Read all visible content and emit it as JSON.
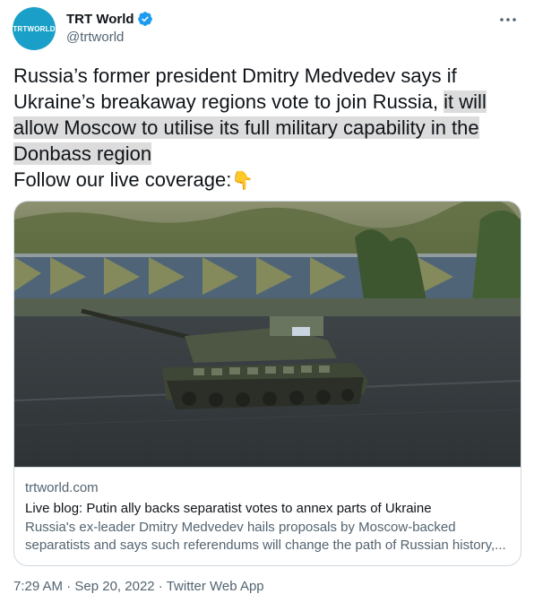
{
  "account": {
    "avatar_text": "TRTWORLD",
    "display_name": "TRT World",
    "handle": "@trtworld",
    "verified_icon": "verified-badge-icon"
  },
  "more_icon": "more-options-icon",
  "tweet": {
    "line_part1": "Russia’s former president Dmitry Medvedev says if Ukraine’s breakaway regions vote to join Russia, ",
    "line_highlight": "it will allow Moscow to utilise its full military capability in the Donbass region",
    "follow_text": "Follow our live coverage:",
    "emoji": "👇"
  },
  "card": {
    "domain": "trtworld.com",
    "title": "Live blog: Putin ally backs separatist votes to annex parts of Ukraine",
    "description": "Russia's ex-leader Dmitry Medvedev hails proposals by Moscow-backed separatists and says such referendums will change the path of Russian history,..."
  },
  "meta": {
    "time": "7:29 AM",
    "separator": " · ",
    "date": "Sep 20, 2022",
    "source": "Twitter Web App"
  },
  "colors": {
    "accent": "#1d9bf0",
    "avatar_bg": "#1aa0c8",
    "muted": "#536471",
    "highlight": "#dcdcdc"
  }
}
